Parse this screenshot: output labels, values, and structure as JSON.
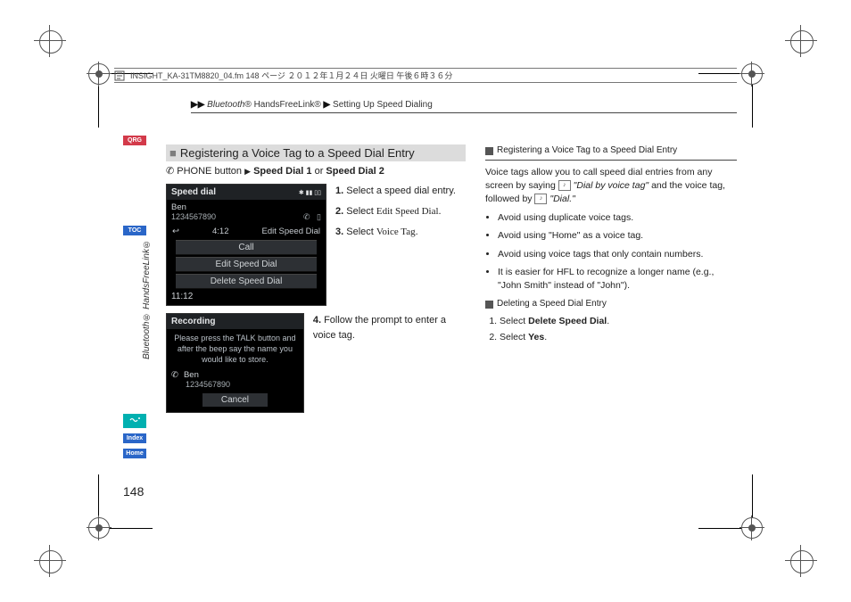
{
  "meta": {
    "framemaker_line": "INSIGHT_KA-31TM8820_04.fm  148 ページ  ２０１２年１月２４日  火曜日  午後６時３６分"
  },
  "breadcrumb": {
    "arrow": "▶▶",
    "part1": "Bluetooth",
    "part2": "® HandsFreeLink®",
    "arrow2": "▶",
    "part3": "Setting Up Speed Dialing"
  },
  "sidebar": {
    "qrg": "QRG",
    "toc": "TOC",
    "index": "Index",
    "home": "Home",
    "vertical": "Bluetooth® HandsFreeLink®"
  },
  "section": {
    "marker": "■",
    "title": "Registering a Voice Tag to a Speed Dial Entry"
  },
  "path": {
    "icon": "✆",
    "phone_btn": "PHONE button",
    "tri": "▶",
    "sd1": "Speed Dial 1",
    "or": " or ",
    "sd2": "Speed Dial 2"
  },
  "screens": {
    "a": {
      "title": "Speed dial",
      "status_icons": "✱ ▮▮ ▯▯",
      "name": "Ben",
      "number": "1234567890",
      "phone_icon": "✆",
      "signal": "▯",
      "left_arrow": "↩",
      "time_small": "4:12",
      "btn1": "Call",
      "btn2": "Edit Speed Dial",
      "btn3": "Delete Speed Dial",
      "time": "11:12"
    },
    "b": {
      "title": "Recording",
      "msg": "Please press the TALK button and after the beep say the name you would like to store.",
      "phone_icon": "✆",
      "name": "Ben",
      "number": "1234567890",
      "cancel": "Cancel"
    }
  },
  "steps": [
    {
      "n": "1.",
      "text": "Select a speed dial entry."
    },
    {
      "n": "2.",
      "pre": "Select ",
      "bold": "Edit Speed Dial",
      "post": "."
    },
    {
      "n": "3.",
      "pre": "Select ",
      "bold": "Voice Tag",
      "post": "."
    },
    {
      "n": "4.",
      "text": "Follow the prompt to enter a voice tag."
    }
  ],
  "right": {
    "head_icon": "≫",
    "head_text": "Registering a Voice Tag to a Speed Dial Entry",
    "intro_a": "Voice tags allow you to call speed dial entries from any screen by saying ",
    "intro_b": " \"Dial by voice tag\"",
    "intro_c": " and the voice tag, followed by ",
    "intro_d": " \"Dial.\"",
    "bullets": [
      "Avoid using duplicate voice tags.",
      "Avoid using \"Home\" as a voice tag.",
      "Avoid using voice tags that only contain numbers.",
      "It is easier for HFL to recognize a longer name (e.g., \"John Smith\" instead of \"John\")."
    ],
    "sub2_icon": "≫",
    "sub2_text": "Deleting a Speed Dial Entry",
    "del_steps": [
      {
        "n": "1.",
        "pre": "Select ",
        "bold": "Delete Speed Dial",
        "post": "."
      },
      {
        "n": "2.",
        "pre": "Select ",
        "bold": "Yes",
        "post": "."
      }
    ]
  },
  "page_number": "148"
}
